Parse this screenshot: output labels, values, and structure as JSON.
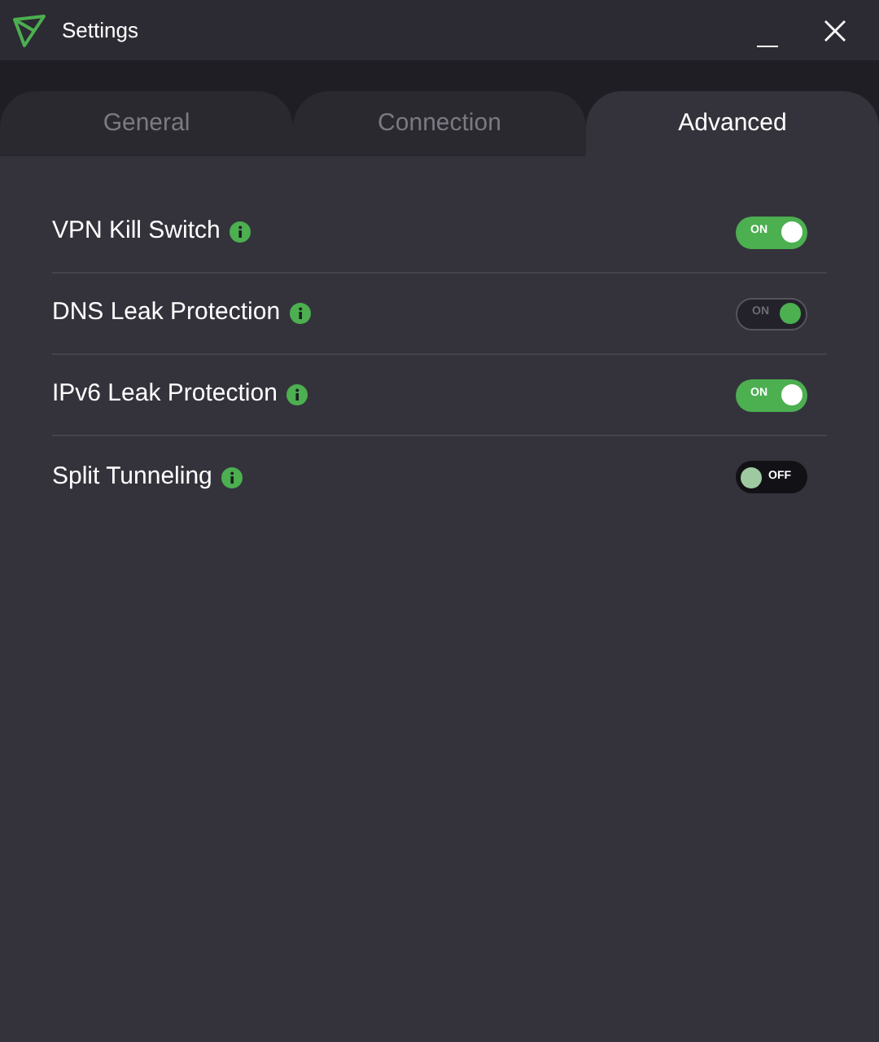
{
  "window": {
    "title": "Settings"
  },
  "tabs": [
    {
      "label": "General",
      "selected": false
    },
    {
      "label": "Connection",
      "selected": false
    },
    {
      "label": "Advanced",
      "selected": true
    }
  ],
  "settings": [
    {
      "label": "VPN Kill Switch",
      "on": true,
      "disabled": false,
      "toggle_text": "ON"
    },
    {
      "label": "DNS Leak Protection",
      "on": true,
      "disabled": true,
      "toggle_text": "ON"
    },
    {
      "label": "IPv6 Leak Protection",
      "on": true,
      "disabled": false,
      "toggle_text": "ON"
    },
    {
      "label": "Split Tunneling",
      "on": false,
      "disabled": false,
      "toggle_text": "OFF"
    }
  ]
}
